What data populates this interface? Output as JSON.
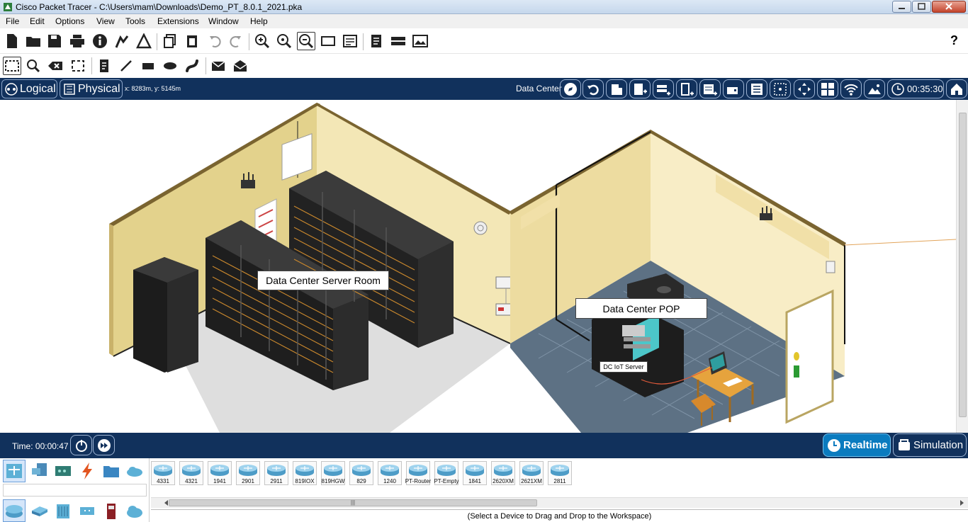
{
  "window": {
    "title": "Cisco Packet Tracer - C:\\Users\\mam\\Downloads\\Demo_PT_8.0.1_2021.pka"
  },
  "menu": [
    "File",
    "Edit",
    "Options",
    "View",
    "Tools",
    "Extensions",
    "Window",
    "Help"
  ],
  "toolbar": {
    "help_label": "?"
  },
  "modebar": {
    "logical_label": "Logical",
    "physical_label": "Physical",
    "coords": "x: 8283m, y: 5145m",
    "location": "Data Center",
    "clock": "00:35:30"
  },
  "workspace": {
    "server_room_label": "Data Center Server Room",
    "pop_label": "Data Center POP",
    "iot_server_label": "DC IoT Server"
  },
  "status": {
    "time": "Time: 00:00:47",
    "realtime_label": "Realtime",
    "simulation_label": "Simulation"
  },
  "devices": [
    "4331",
    "4321",
    "1941",
    "2901",
    "2911",
    "819IOX",
    "819HGW",
    "829",
    "1240",
    "PT-Router",
    "PT-Empty",
    "1841",
    "2620XM",
    "2621XM",
    "2811"
  ],
  "hint": "(Select a Device to Drag and Drop to the Workspace)",
  "colors": {
    "nav_bg": "#11315c",
    "realtime_active": "#0a7bbf",
    "wall_left": "#e3d28c",
    "wall_right": "#f3e7b6",
    "floor_pop": "#5d7184"
  }
}
